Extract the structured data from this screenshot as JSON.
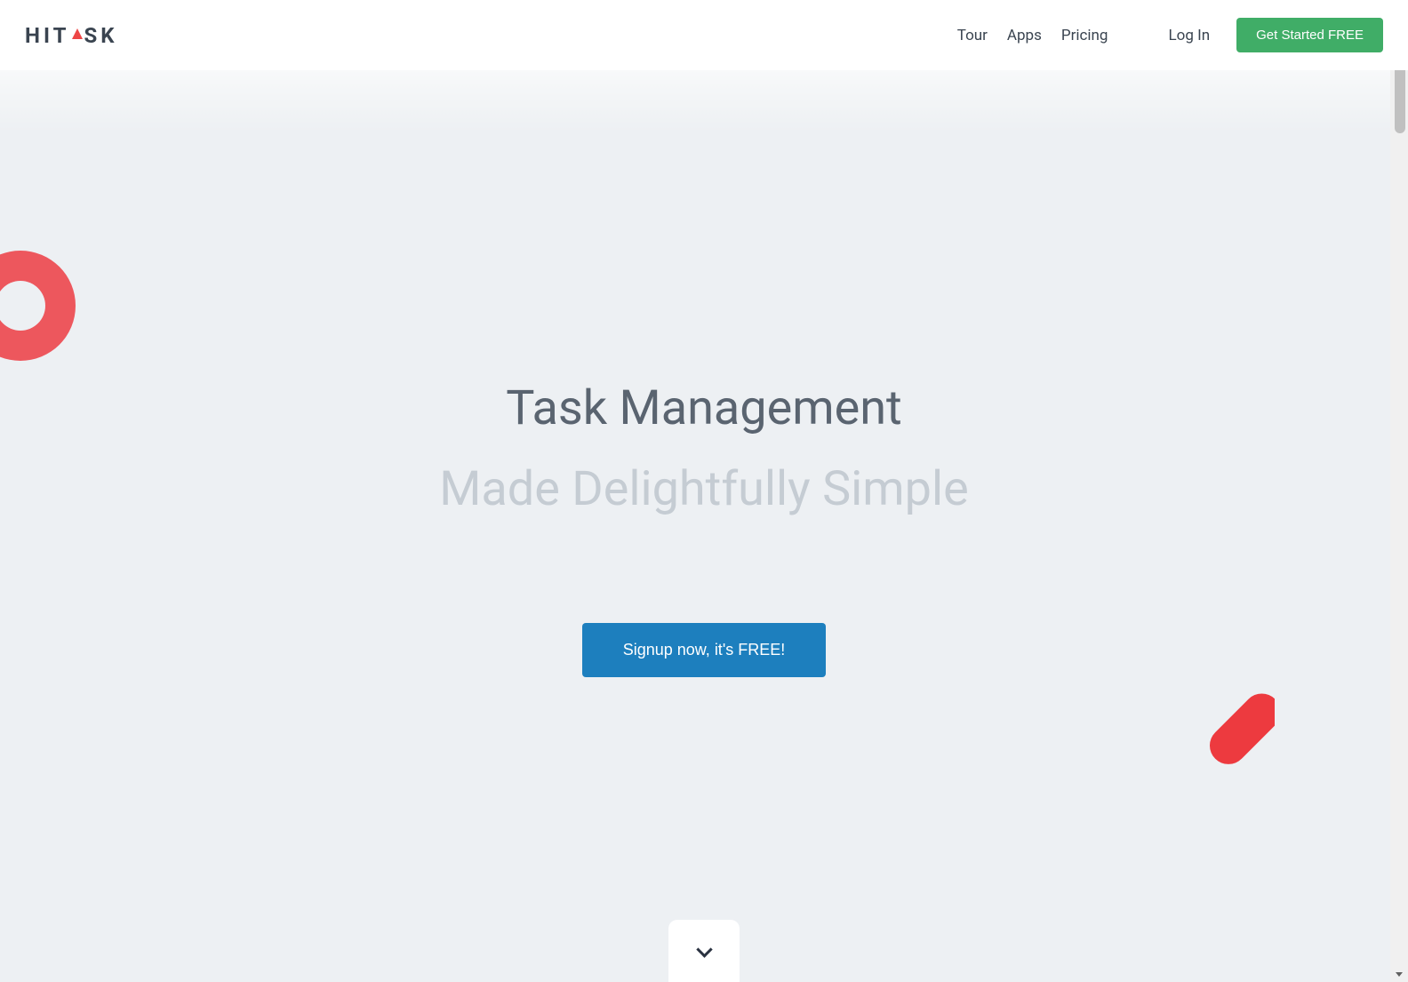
{
  "brand": {
    "name": "HITASK",
    "name_prefix": "HIT",
    "name_suffix": "SK"
  },
  "nav": {
    "tour": "Tour",
    "apps": "Apps",
    "pricing": "Pricing",
    "login": "Log In",
    "cta": "Get Started FREE"
  },
  "hero": {
    "title": "Task Management",
    "subtitle": "Made Delightfully Simple",
    "signup_button": "Signup now, it's FREE!"
  },
  "colors": {
    "accent_red": "#ed4646",
    "cta_green": "#40ad67",
    "signup_blue": "#1d7fbe",
    "text_primary": "#5a6470",
    "text_faded": "#c5ccd3",
    "bg_hero": "#edf0f3"
  }
}
